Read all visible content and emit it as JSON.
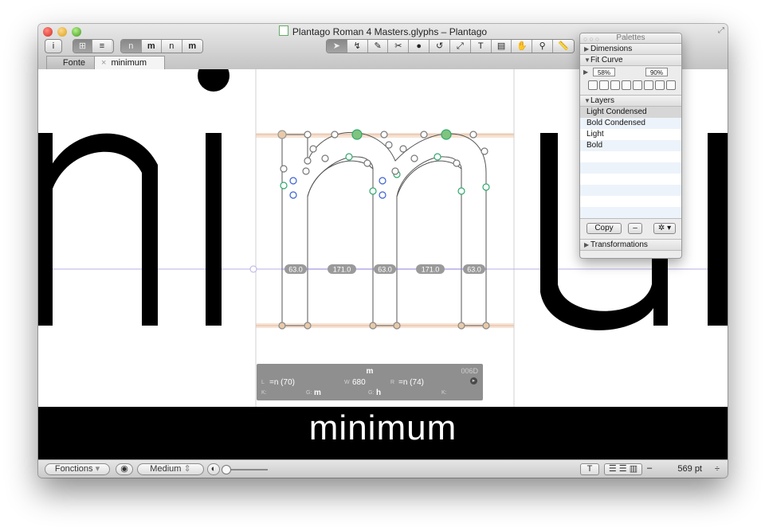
{
  "window": {
    "title": "Plantago Roman 4 Masters.glyphs – Plantago"
  },
  "tabs": [
    {
      "label": "Fonte"
    },
    {
      "label": "minimum",
      "close": "×"
    }
  ],
  "toolbar_left": {
    "info_label": "i",
    "view_icons": [
      "⊞",
      "≡"
    ],
    "glyph_previews": [
      "n",
      "m",
      "n",
      "m"
    ]
  },
  "toolbar_tools": [
    "select",
    "select-all",
    "draw",
    "knife",
    "primitives",
    "rotate",
    "scale",
    "text",
    "annotation",
    "hand",
    "zoom",
    "measure"
  ],
  "tool_glyphs": [
    "➤",
    "↯",
    "✎",
    "✂",
    "●",
    "↺",
    "⤢",
    "T",
    "▤",
    "✋",
    "⚲",
    "📏"
  ],
  "canvas": {
    "metrics": [
      "63.0",
      "171.0",
      "63.0",
      "171.0",
      "63.0"
    ],
    "big_glyphs_left": "ni",
    "big_glyphs_right": "ur",
    "colors": {
      "guide": "#b8b0e8",
      "metric_band": "#f7e3d3",
      "node_green": "#2fa86b",
      "node_blue": "#3a5fd1",
      "node_grey": "#777777"
    }
  },
  "glyph_info": {
    "name": "m",
    "unicode": "006D",
    "lsb_label": "L",
    "lsb": "=n (70)",
    "width_label": "W",
    "width": "680",
    "rsb_label": "R",
    "rsb": "=n (74)",
    "k_left_label": "K:",
    "group_left_label": "G:",
    "group_left": "m",
    "group_right_label": "G:",
    "group_right": "h",
    "k_right_label": "K:"
  },
  "preview": {
    "text": "minimum"
  },
  "statusbar": {
    "functions": "Fonctions",
    "weight": "Medium",
    "zoom": "569 pt",
    "plusminus": "÷",
    "minus": "–"
  },
  "palettes": {
    "title": "Palettes",
    "sections": {
      "dimensions": "Dimensions",
      "fit_curve": "Fit Curve",
      "layers": "Layers",
      "transformations": "Transformations"
    },
    "fit_curve_min": "58%",
    "fit_curve_max": "90%",
    "layers": [
      "Light Condensed",
      "Bold Condensed",
      "Light",
      "Bold"
    ],
    "copy_label": "Copy",
    "remove_label": "–",
    "gear_label": "✲ ▾"
  }
}
